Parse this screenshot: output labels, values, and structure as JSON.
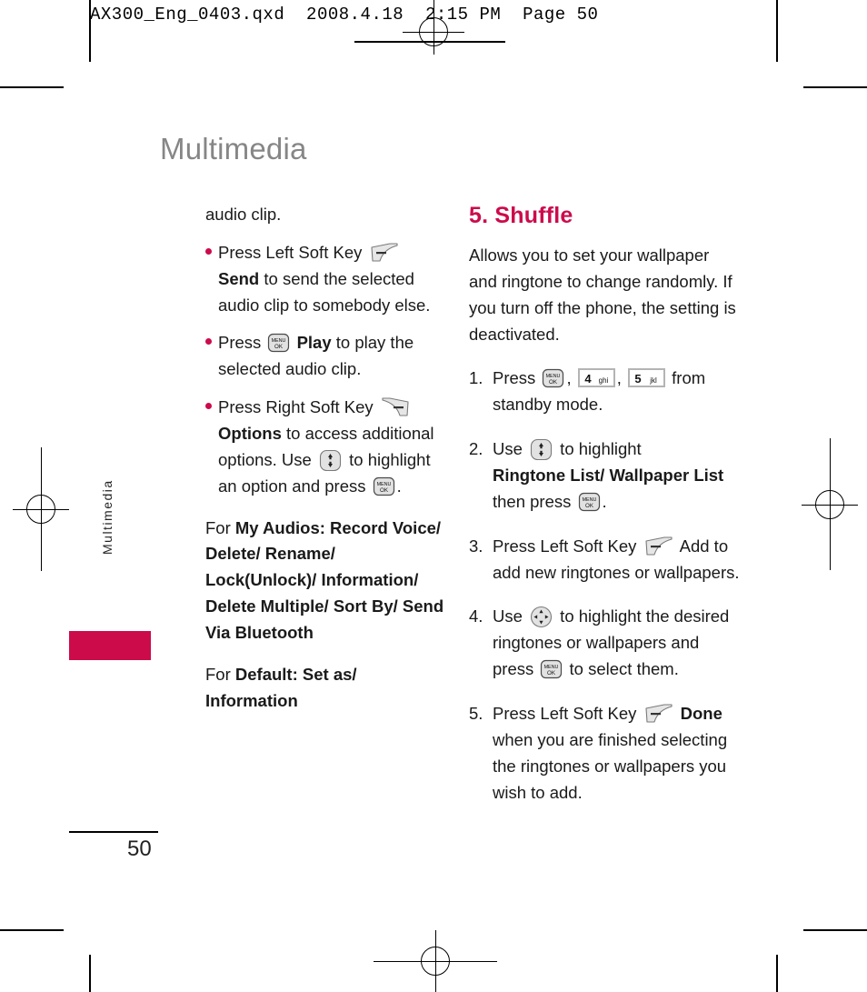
{
  "print_slug": "AX300_Eng_0403.qxd  2008.4.18  2:15 PM  Page 50",
  "page_title": "Multimedia",
  "side_tab_label": "Multimedia",
  "folio": "50",
  "accent_color": "#cc0b4b",
  "title_color": "#868686",
  "left_column": {
    "intro": "audio clip.",
    "bullets": [
      {
        "part1": "Press Left Soft Key",
        "icon": "left-soft-key-icon",
        "bold": "Send",
        "part2": " to send the selected audio clip to somebody else."
      },
      {
        "part1": "Press",
        "icon": "menu-ok-key-icon",
        "bold": "Play",
        "part2": " to play the selected audio clip."
      },
      {
        "part1": "Press Right Soft Key",
        "icon": "right-soft-key-icon",
        "bold": "Options",
        "part2": " to access additional options. Use",
        "icon2": "updown-nav-key-icon",
        "part3": " to highlight an option and press",
        "icon3": "menu-ok-key-icon",
        "part4": "."
      }
    ],
    "para_my_audios_lead": "For ",
    "para_my_audios_bold": "My Audios: Record Voice/ Delete/ Rename/ Lock(Unlock)/ Information/ Delete Multiple/ Sort By/ Send Via Bluetooth",
    "para_default_lead": "For ",
    "para_default_bold": "Default: Set as/ Information"
  },
  "right_column": {
    "section_heading": "5. Shuffle",
    "section_intro": "Allows you to set your wallpaper and ringtone to change randomly. If you turn off the phone, the setting is deactivated.",
    "steps": [
      {
        "num": "1.",
        "part1": "Press",
        "icon1": "menu-ok-key-icon",
        "sep1": ",",
        "key2_digit": "4",
        "key2_letters": "ghi",
        "sep2": ",",
        "key3_digit": "5",
        "key3_letters": "jkl",
        "part2": " from standby mode."
      },
      {
        "num": "2.",
        "part1": "Use",
        "icon1": "updown-nav-key-icon",
        "part2": " to highlight",
        "bold": "Ringtone List/ Wallpaper List",
        "part3": " then press",
        "icon2": "menu-ok-key-icon",
        "part4": "."
      },
      {
        "num": "3.",
        "part1": "Press Left Soft Key",
        "icon1": "left-soft-key-icon",
        "part2": " Add to add new ringtones or wallpapers."
      },
      {
        "num": "4.",
        "part1": "Use",
        "icon1": "fourway-nav-key-icon",
        "part2": " to highlight the desired ringtones or wallpapers and press",
        "icon2": "menu-ok-key-icon",
        "part3": " to select them."
      },
      {
        "num": "5.",
        "part1": "Press Left Soft Key",
        "icon1": "left-soft-key-icon",
        "bold": "Done",
        "part2": " when you are finished selecting the ringtones or wallpapers you wish to add."
      }
    ]
  }
}
